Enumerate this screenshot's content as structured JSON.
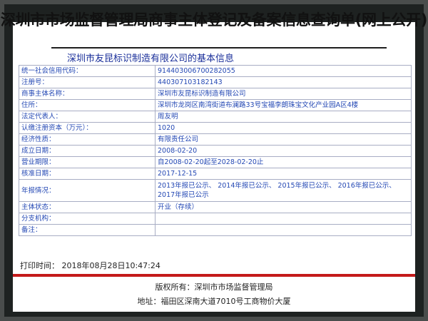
{
  "document": {
    "title": "深圳市市场监督管理局商事主体登记及备案信息查询单(网上公开)",
    "subtitle": "深圳市友昆标识制造有限公司的基本信息",
    "fields": [
      {
        "label": "统一社会信用代码：",
        "value": "914403006700282055"
      },
      {
        "label": "注册号：",
        "value": "440307103182143"
      },
      {
        "label": "商事主体名称：",
        "value": "深圳市友昆标识制造有限公司"
      },
      {
        "label": "住所：",
        "value": "深圳市龙岗区南湾街道布澜路33号宝福李朗珠宝文化产业园A区4楼"
      },
      {
        "label": "法定代表人：",
        "value": "周友明"
      },
      {
        "label": "认缴注册资本（万元）：",
        "value": "1020"
      },
      {
        "label": "经济性质：",
        "value": "有限责任公司"
      },
      {
        "label": "成立日期：",
        "value": "2008-02-20"
      },
      {
        "label": "营业期限：",
        "value": "自2008-02-20起至2028-02-20止"
      },
      {
        "label": "核准日期：",
        "value": "2017-12-15"
      },
      {
        "label": "年报情况：",
        "value": "2013年报已公示、 2014年报已公示、 2015年报已公示、 2016年报已公示、 2017年报已公示"
      },
      {
        "label": "主体状态：",
        "value": "开业（存续）"
      },
      {
        "label": "分支机构：",
        "value": ""
      },
      {
        "label": "备注：",
        "value": ""
      }
    ],
    "print_time": "打印时间： 2018年08月28日10:47:24",
    "footer": {
      "copyright": "版权所有：深圳市市场监督管理局",
      "address": "地址：福田区深南大道7010号工商物价大厦"
    }
  }
}
